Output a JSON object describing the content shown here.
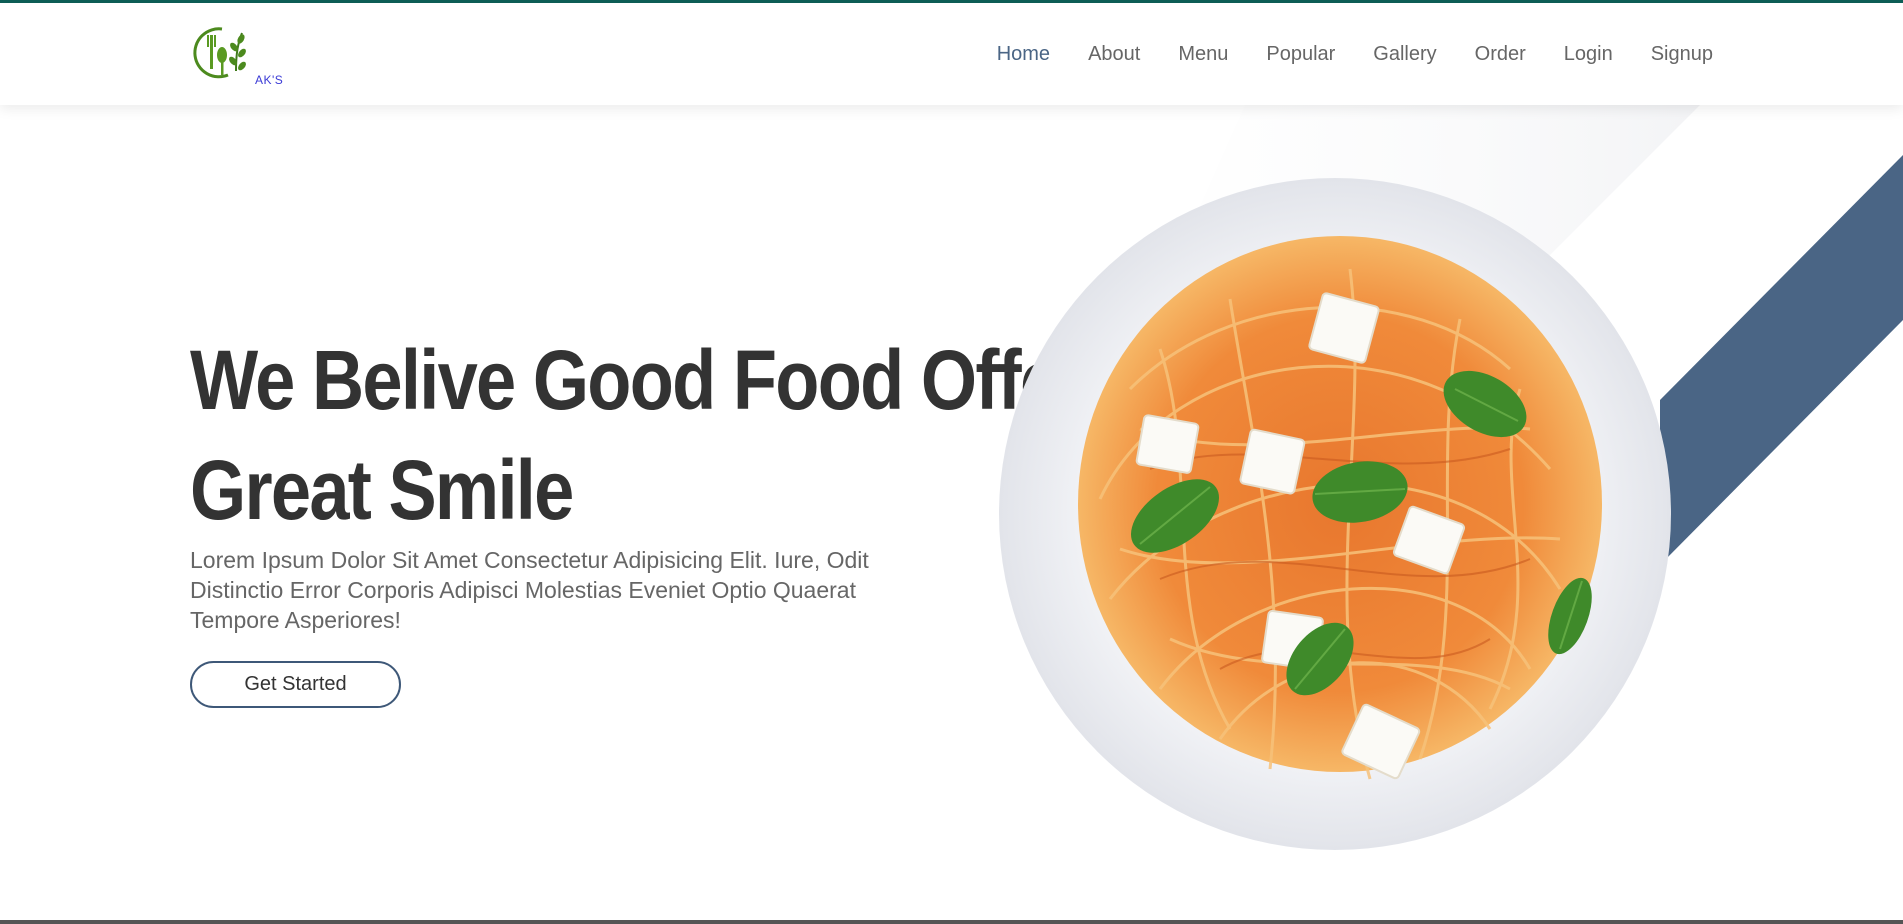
{
  "brand": {
    "name": "AK'S",
    "accent_color": "#4a6585",
    "logo_icon": "fork-spoon-herb-icon"
  },
  "nav": {
    "items": [
      {
        "label": "Home",
        "active": true
      },
      {
        "label": "About"
      },
      {
        "label": "Menu"
      },
      {
        "label": "Popular"
      },
      {
        "label": "Gallery"
      },
      {
        "label": "Order"
      },
      {
        "label": "Login"
      },
      {
        "label": "Signup"
      }
    ]
  },
  "hero": {
    "title_line1": "We Belive Good Food Offer",
    "title_line2": "Great Smile",
    "description": "Lorem Ipsum Dolor Sit Amet Consectetur Adipisicing Elit. Iure, Odit Distinctio Error Corporis Adipisci Molestias Eveniet Optio Quaerat Tempore Asperiores!",
    "cta_label": "Get Started",
    "image": "spaghetti-plate-image"
  }
}
